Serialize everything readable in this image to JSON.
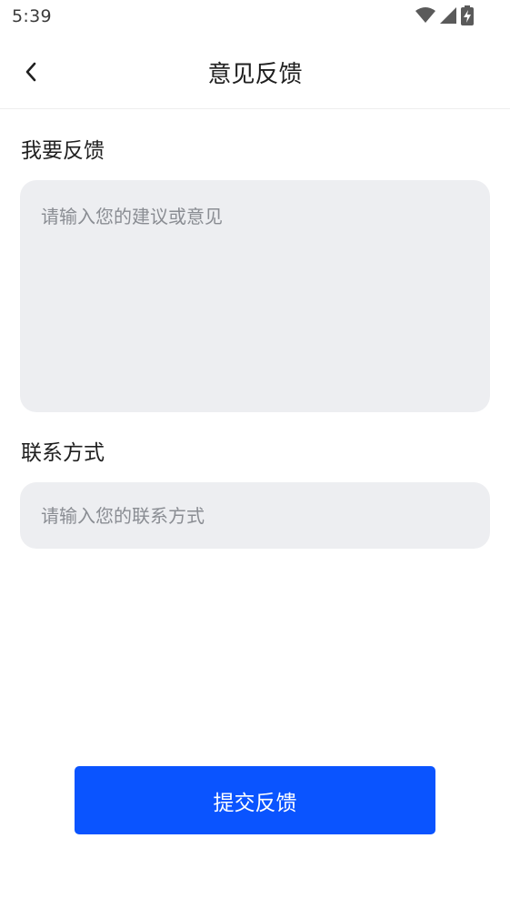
{
  "status_bar": {
    "time": "5:39",
    "icons": [
      "wifi-icon",
      "signal-icon",
      "battery-charging-icon"
    ]
  },
  "nav": {
    "back_icon": "chevron-left-icon",
    "title": "意见反馈"
  },
  "form": {
    "feedback_label": "我要反馈",
    "feedback_placeholder": "请输入您的建议或意见",
    "feedback_value": "",
    "contact_label": "联系方式",
    "contact_placeholder": "请输入您的联系方式",
    "contact_value": ""
  },
  "submit": {
    "label": "提交反馈"
  },
  "colors": {
    "accent": "#0a54ff",
    "input_bg": "#edeef1",
    "placeholder": "#8a8d93"
  }
}
